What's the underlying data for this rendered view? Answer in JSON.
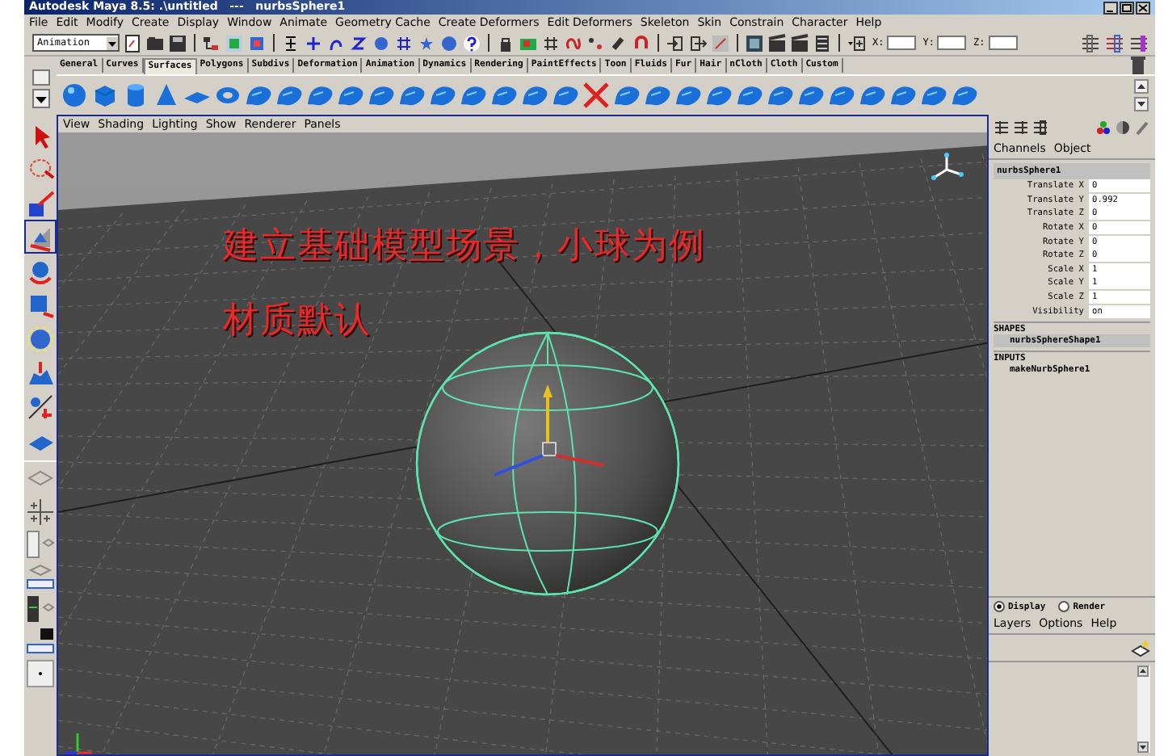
{
  "window": {
    "title": "Autodesk Maya 8.5: .\\untitled   ---   nurbsSphere1"
  },
  "menu_bar": [
    "File",
    "Edit",
    "Modify",
    "Create",
    "Display",
    "Window",
    "Animate",
    "Geometry Cache",
    "Create Deformers",
    "Edit Deformers",
    "Skeleton",
    "Skin",
    "Constrain",
    "Character",
    "Help"
  ],
  "status_line": {
    "mode": "Animation",
    "coord_labels": [
      "X:",
      "Y:",
      "Z:"
    ]
  },
  "shelf_tabs": [
    {
      "label": "General",
      "selected": false
    },
    {
      "label": "Curves",
      "selected": false
    },
    {
      "label": "Surfaces",
      "selected": true
    },
    {
      "label": "Polygons",
      "selected": false
    },
    {
      "label": "Subdivs",
      "selected": false
    },
    {
      "label": "Deformation",
      "selected": false
    },
    {
      "label": "Animation",
      "selected": false
    },
    {
      "label": "Dynamics",
      "selected": false
    },
    {
      "label": "Rendering",
      "selected": false
    },
    {
      "label": "PaintEffects",
      "selected": false
    },
    {
      "label": "Toon",
      "selected": false
    },
    {
      "label": "Fluids",
      "selected": false
    },
    {
      "label": "Fur",
      "selected": false
    },
    {
      "label": "Hair",
      "selected": false
    },
    {
      "label": "nCloth",
      "selected": false
    },
    {
      "label": "Cloth",
      "selected": false
    },
    {
      "label": "Custom",
      "selected": false
    }
  ],
  "viewport": {
    "menu": [
      "View",
      "Shading",
      "Lighting",
      "Show",
      "Renderer",
      "Panels"
    ],
    "overlay_text": [
      "建立基础模型场景，小球为例",
      "材质默认"
    ]
  },
  "channel_box": {
    "menu": [
      "Channels",
      "Object"
    ],
    "object": "nurbsSphere1",
    "attributes": [
      {
        "name": "Translate X",
        "value": "0"
      },
      {
        "name": "Translate Y",
        "value": "0.992"
      },
      {
        "name": "Translate Z",
        "value": "0"
      },
      {
        "name": "Rotate X",
        "value": "0"
      },
      {
        "name": "Rotate Y",
        "value": "0"
      },
      {
        "name": "Rotate Z",
        "value": "0"
      },
      {
        "name": "Scale X",
        "value": "1"
      },
      {
        "name": "Scale Y",
        "value": "1"
      },
      {
        "name": "Scale Z",
        "value": "1"
      },
      {
        "name": "Visibility",
        "value": "on"
      }
    ],
    "shapes_header": "SHAPES",
    "shape": "nurbsSphereShape1",
    "inputs_header": "INPUTS",
    "input": "makeNurbSphere1"
  },
  "layer_editor": {
    "modes": [
      {
        "label": "Display",
        "selected": true
      },
      {
        "label": "Render",
        "selected": false
      }
    ],
    "menu": [
      "Layers",
      "Options",
      "Help"
    ]
  }
}
